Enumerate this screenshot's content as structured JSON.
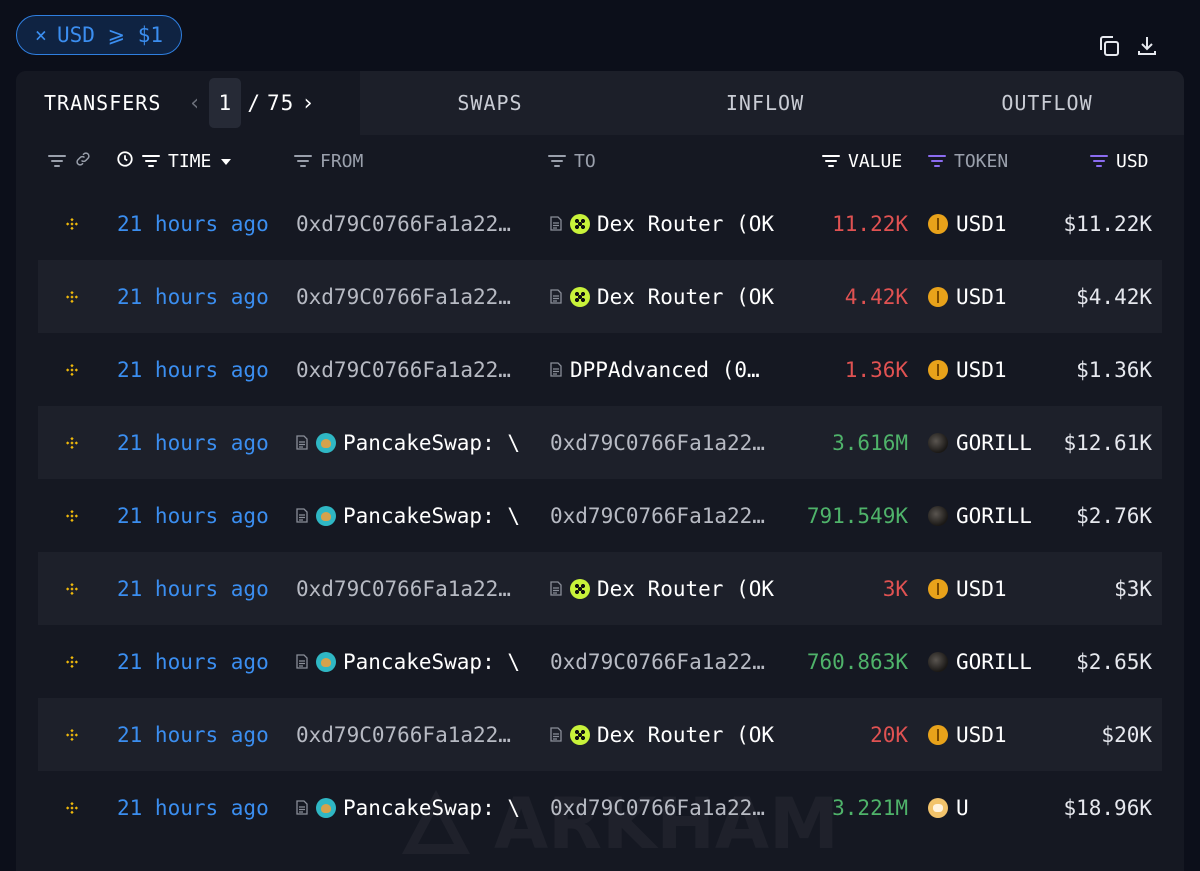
{
  "filter_chip": {
    "close_symbol": "×",
    "label": "USD ⩾ $1"
  },
  "top_icons": [
    "copy-icon",
    "download-icon"
  ],
  "tabs": {
    "transfers": "TRANSFERS",
    "pager": {
      "current": "1",
      "separator": "/",
      "total": "75",
      "prev_symbol": "‹",
      "next_symbol": "›"
    },
    "swaps": "SWAPS",
    "inflow": "INFLOW",
    "outflow": "OUTFLOW"
  },
  "columns": {
    "time": "TIME",
    "from": "FROM",
    "to": "TO",
    "value": "VALUE",
    "token": "TOKEN",
    "usd": "USD"
  },
  "rows": [
    {
      "time": "21 hours ago",
      "from": "0xd79C0766Fa1a22…",
      "from_type": "address",
      "to": "Dex Router (OK",
      "to_type": "okx",
      "value": "11.22K",
      "value_dir": "out",
      "token": "USD1",
      "token_icon": "usd1",
      "usd": "$11.22K"
    },
    {
      "time": "21 hours ago",
      "from": "0xd79C0766Fa1a22…",
      "from_type": "address",
      "to": "Dex Router (OK",
      "to_type": "okx",
      "value": "4.42K",
      "value_dir": "out",
      "token": "USD1",
      "token_icon": "usd1",
      "usd": "$4.42K"
    },
    {
      "time": "21 hours ago",
      "from": "0xd79C0766Fa1a22…",
      "from_type": "address",
      "to": "DPPAdvanced (0…",
      "to_type": "contract",
      "value": "1.36K",
      "value_dir": "out",
      "token": "USD1",
      "token_icon": "usd1",
      "usd": "$1.36K"
    },
    {
      "time": "21 hours ago",
      "from": "PancakeSwap: \\",
      "from_type": "cake",
      "to": "0xd79C0766Fa1a22…",
      "to_type": "address",
      "value": "3.616M",
      "value_dir": "in",
      "token": "GORILL",
      "token_icon": "gorilla",
      "usd": "$12.61K"
    },
    {
      "time": "21 hours ago",
      "from": "PancakeSwap: \\",
      "from_type": "cake",
      "to": "0xd79C0766Fa1a22…",
      "to_type": "address",
      "value": "791.549K",
      "value_dir": "in",
      "token": "GORILL",
      "token_icon": "gorilla",
      "usd": "$2.76K"
    },
    {
      "time": "21 hours ago",
      "from": "0xd79C0766Fa1a22…",
      "from_type": "address",
      "to": "Dex Router (OK",
      "to_type": "okx",
      "value": "3K",
      "value_dir": "out",
      "token": "USD1",
      "token_icon": "usd1",
      "usd": "$3K"
    },
    {
      "time": "21 hours ago",
      "from": "PancakeSwap: \\",
      "from_type": "cake",
      "to": "0xd79C0766Fa1a22…",
      "to_type": "address",
      "value": "760.863K",
      "value_dir": "in",
      "token": "GORILL",
      "token_icon": "gorilla",
      "usd": "$2.65K"
    },
    {
      "time": "21 hours ago",
      "from": "0xd79C0766Fa1a22…",
      "from_type": "address",
      "to": "Dex Router (OK",
      "to_type": "okx",
      "value": "20K",
      "value_dir": "out",
      "token": "USD1",
      "token_icon": "usd1",
      "usd": "$20K"
    },
    {
      "time": "21 hours ago",
      "from": "PancakeSwap: \\",
      "from_type": "cake",
      "to": "0xd79C0766Fa1a22…",
      "to_type": "address",
      "value": "3.221M",
      "value_dir": "in",
      "token": "U",
      "token_icon": "u",
      "usd": "$18.96K"
    }
  ],
  "watermark": "ARKHAM",
  "colors": {
    "accent": "#3b8ef0",
    "negative": "#e05252",
    "positive": "#4fb36a",
    "chain": "#f0b90b",
    "token_filter": "#8b6cf0"
  }
}
